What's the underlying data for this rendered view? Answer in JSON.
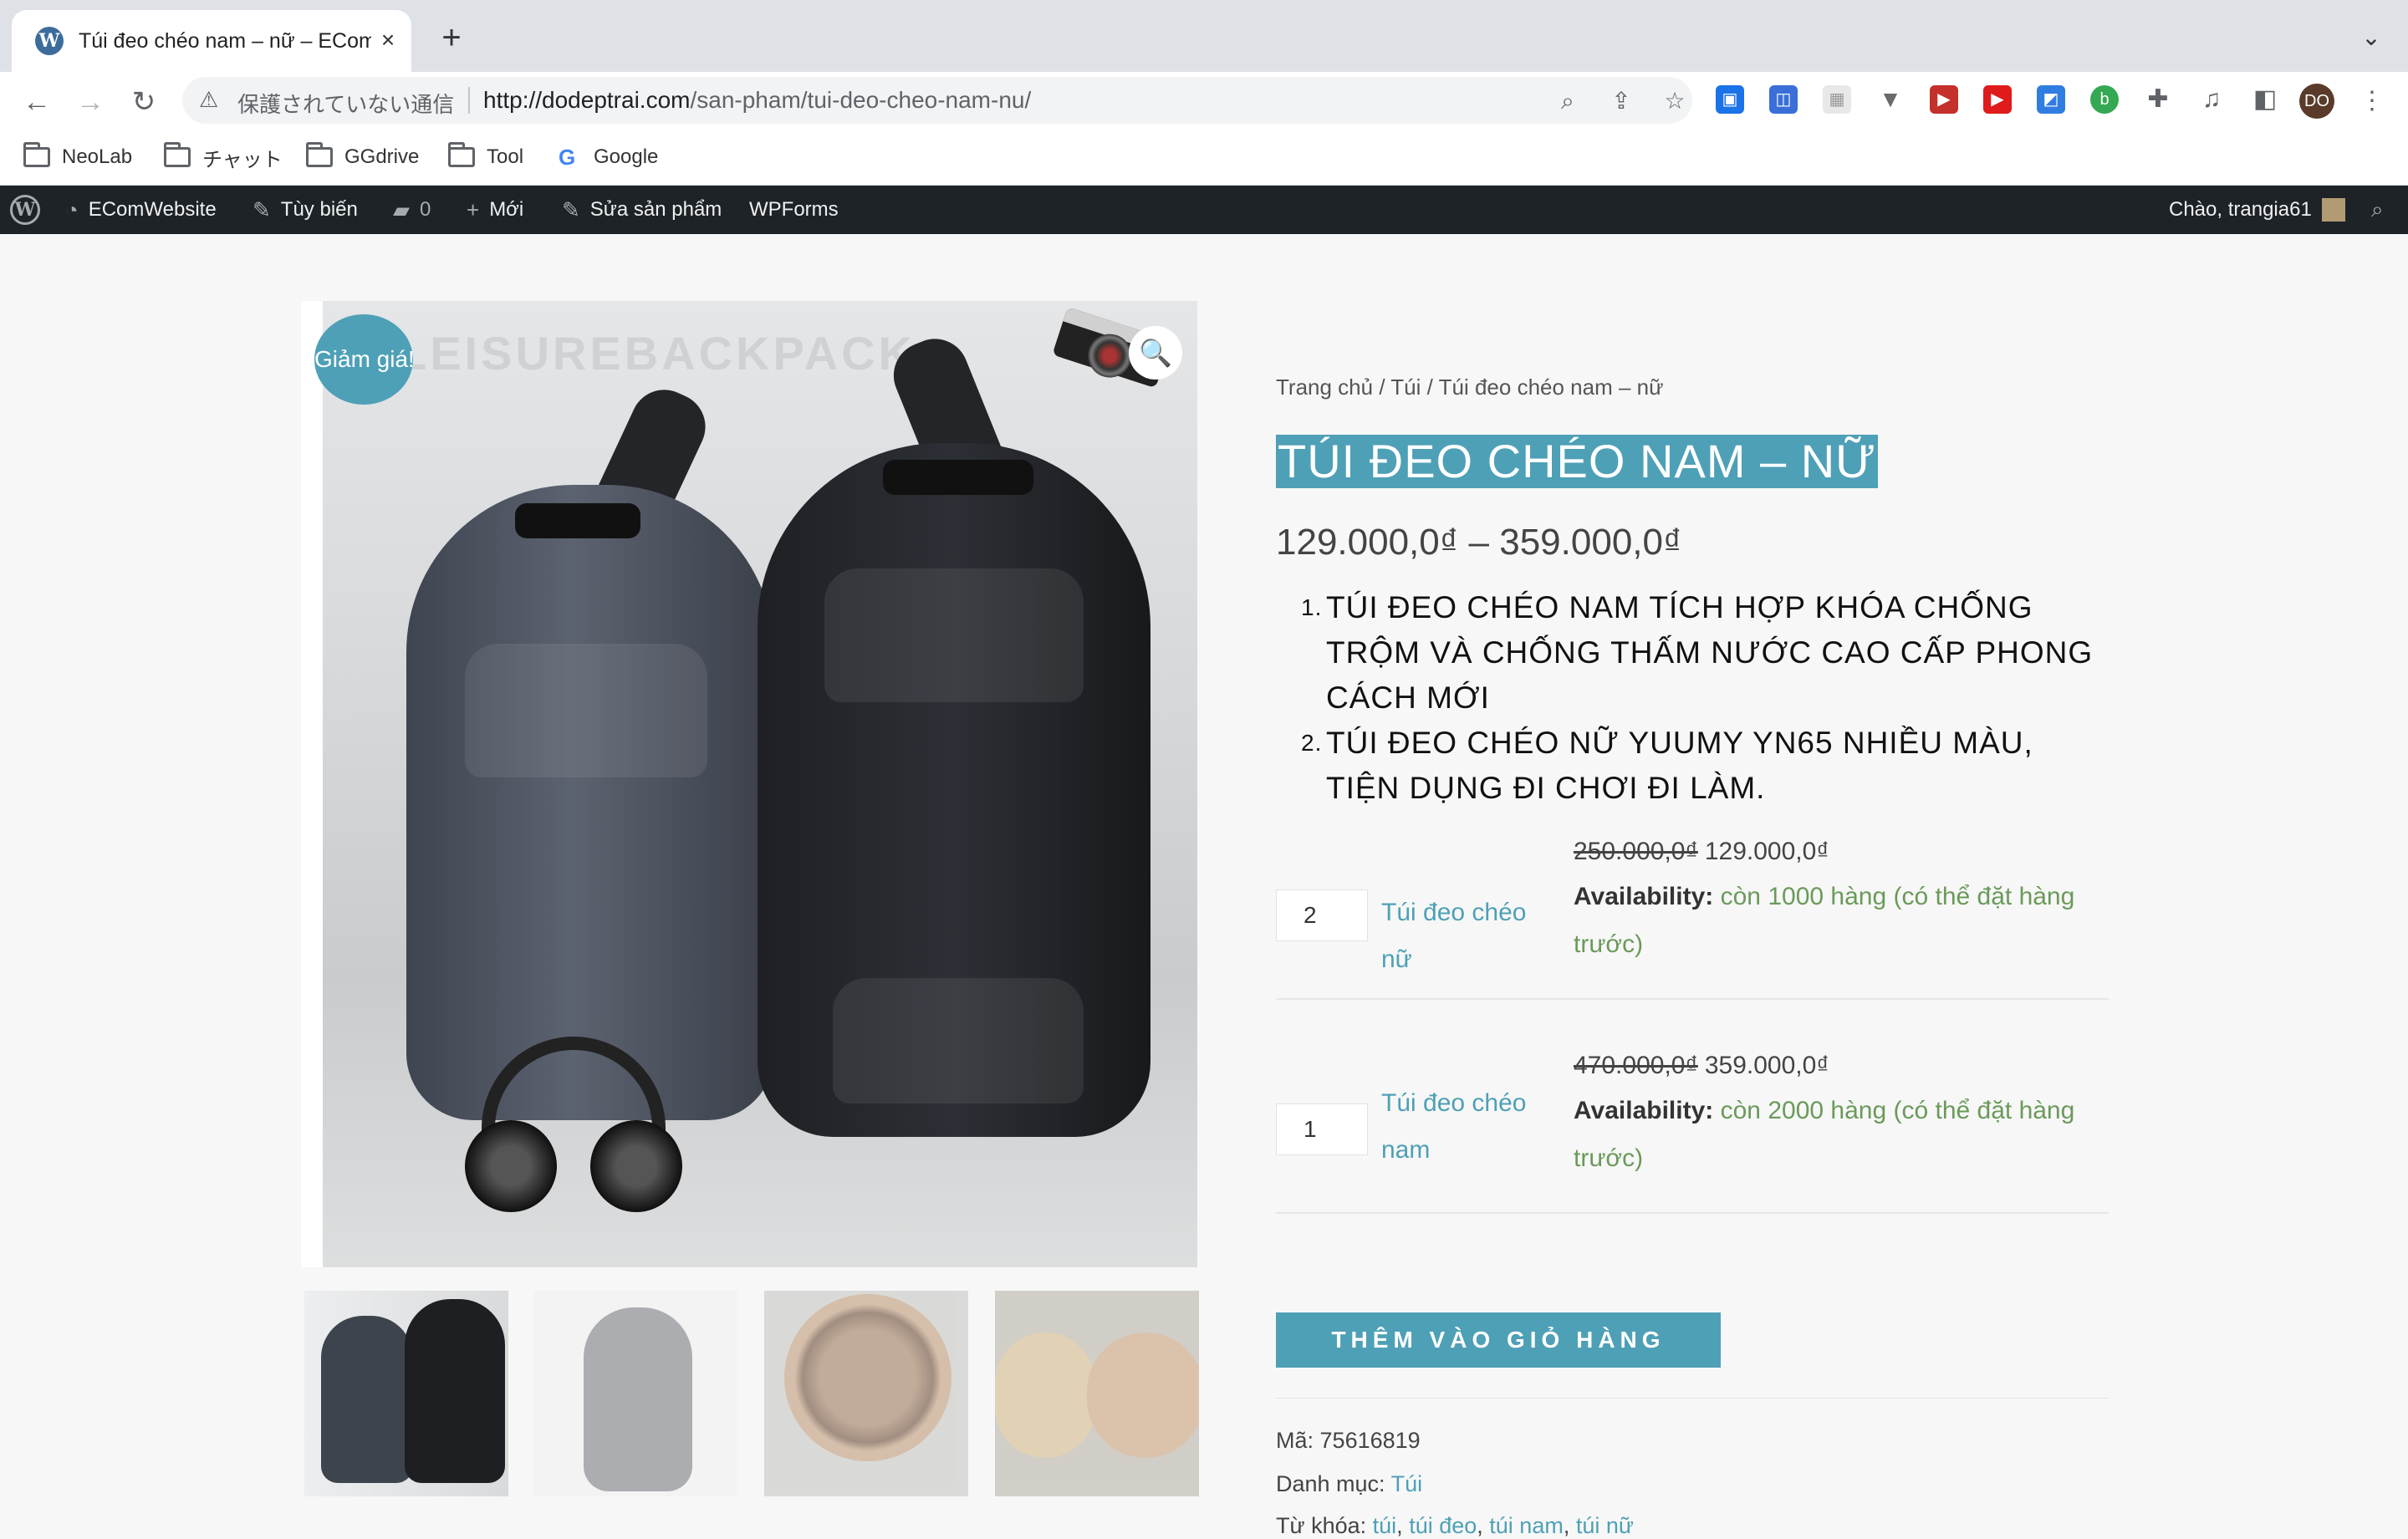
{
  "browser": {
    "tab_title": "Túi đeo chéo nam – nữ – ECom",
    "tab_close": "×",
    "new_tab": "+",
    "security_label": "保護されていない通信",
    "url_domain": "http://dodeptrai.com",
    "url_path": "/san-pham/tui-deo-cheo-nam-nu/",
    "avatar_initials": "DO",
    "bookmarks": [
      "NeoLab",
      "チャット",
      "GGdrive",
      "Tool",
      "Google"
    ]
  },
  "wp_admin_bar": {
    "site_name": "EComWebsite",
    "customize": "Tùy biến",
    "comments_count": "0",
    "new": "Mới",
    "edit_product": "Sửa sản phẩm",
    "wpforms": "WPForms",
    "greeting": "Chào, trangia61"
  },
  "gallery": {
    "sale_badge": "Giảm giá!",
    "background_text": "LEISUREBACKPACK",
    "zoom_icon": "🔍"
  },
  "product": {
    "breadcrumb": "Trang chủ / Túi / Túi đeo chéo nam – nữ",
    "title": "TÚI ĐEO CHÉO NAM – NỮ",
    "price_range": "129.000,0₫ – 359.000,0₫",
    "description": [
      {
        "num": "1.",
        "text": "TÚI ĐEO CHÉO NAM TÍCH HỢP KHÓA CHỐNG TRỘM VÀ CHỐNG THẤM NƯỚC CAO CẤP PHONG CÁCH MỚI"
      },
      {
        "num": "2.",
        "text": "TÚI ĐEO CHÉO NỮ YUUMY YN65 NHIỀU MÀU, TIỆN DỤNG ĐI CHƠI ĐI LÀM."
      }
    ],
    "variants": [
      {
        "qty": "2",
        "name": "Túi đeo chéo nữ",
        "old_price": "250.000,0₫",
        "price": "129.000,0₫",
        "availability_label": "Availability:",
        "availability": "còn 1000 hàng (có thể đặt hàng trước)"
      },
      {
        "qty": "1",
        "name": "Túi đeo chéo nam",
        "old_price": "470.000,0₫",
        "price": "359.000,0₫",
        "availability_label": "Availability:",
        "availability": "còn 2000 hàng (có thể đặt hàng trước)"
      }
    ],
    "add_to_cart": "THÊM VÀO GIỎ HÀNG",
    "sku_label": "Mã:",
    "sku": "75616819",
    "category_label": "Danh mục:",
    "category": "Túi",
    "tags_label": "Từ khóa:",
    "tags": [
      "túi",
      "túi đeo",
      "túi nam",
      "túi nữ"
    ]
  },
  "colors": {
    "accent": "#4ea0b6",
    "admin_bar": "#1d2327",
    "availability": "#6a9a5a"
  }
}
